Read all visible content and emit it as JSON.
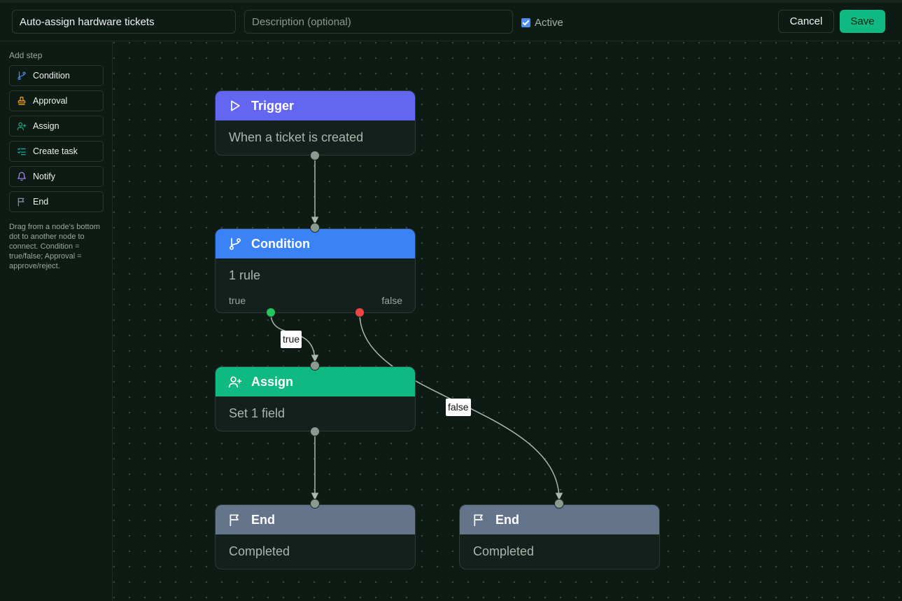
{
  "header": {
    "name_value": "Auto-assign hardware tickets",
    "description_placeholder": "Description (optional)",
    "active_label": "Active",
    "active_checked": true,
    "cancel_label": "Cancel",
    "save_label": "Save"
  },
  "sidebar": {
    "title": "Add step",
    "items": [
      {
        "label": "Condition",
        "icon": "git-branch-icon",
        "color": "#4f8ef7"
      },
      {
        "label": "Approval",
        "icon": "stamp-icon",
        "color": "#f5a524"
      },
      {
        "label": "Assign",
        "icon": "user-plus-icon",
        "color": "#10b981"
      },
      {
        "label": "Create task",
        "icon": "list-checks-icon",
        "color": "#14b8a6"
      },
      {
        "label": "Notify",
        "icon": "bell-icon",
        "color": "#a78bfa"
      },
      {
        "label": "End",
        "icon": "flag-icon",
        "color": "#8a9aa6"
      }
    ],
    "hint": "Drag from a node's bottom dot to another node to connect. Condition = true/false; Approval = approve/reject."
  },
  "canvas": {
    "nodes": [
      {
        "id": "trigger",
        "title": "Trigger",
        "body": "When a ticket is created",
        "icon": "play-icon",
        "color": "#6366f1"
      },
      {
        "id": "condition",
        "title": "Condition",
        "body": "1 rule",
        "icon": "git-branch-icon",
        "color": "#3b82f6",
        "true_label": "true",
        "false_label": "false"
      },
      {
        "id": "assign",
        "title": "Assign",
        "body": "Set 1 field",
        "icon": "user-plus-icon",
        "color": "#10b981"
      },
      {
        "id": "end1",
        "title": "End",
        "body": "Completed",
        "icon": "flag-icon",
        "color": "#64748b"
      },
      {
        "id": "end2",
        "title": "End",
        "body": "Completed",
        "icon": "flag-icon",
        "color": "#64748b"
      }
    ],
    "edge_labels": {
      "true": "true",
      "false": "false"
    }
  }
}
